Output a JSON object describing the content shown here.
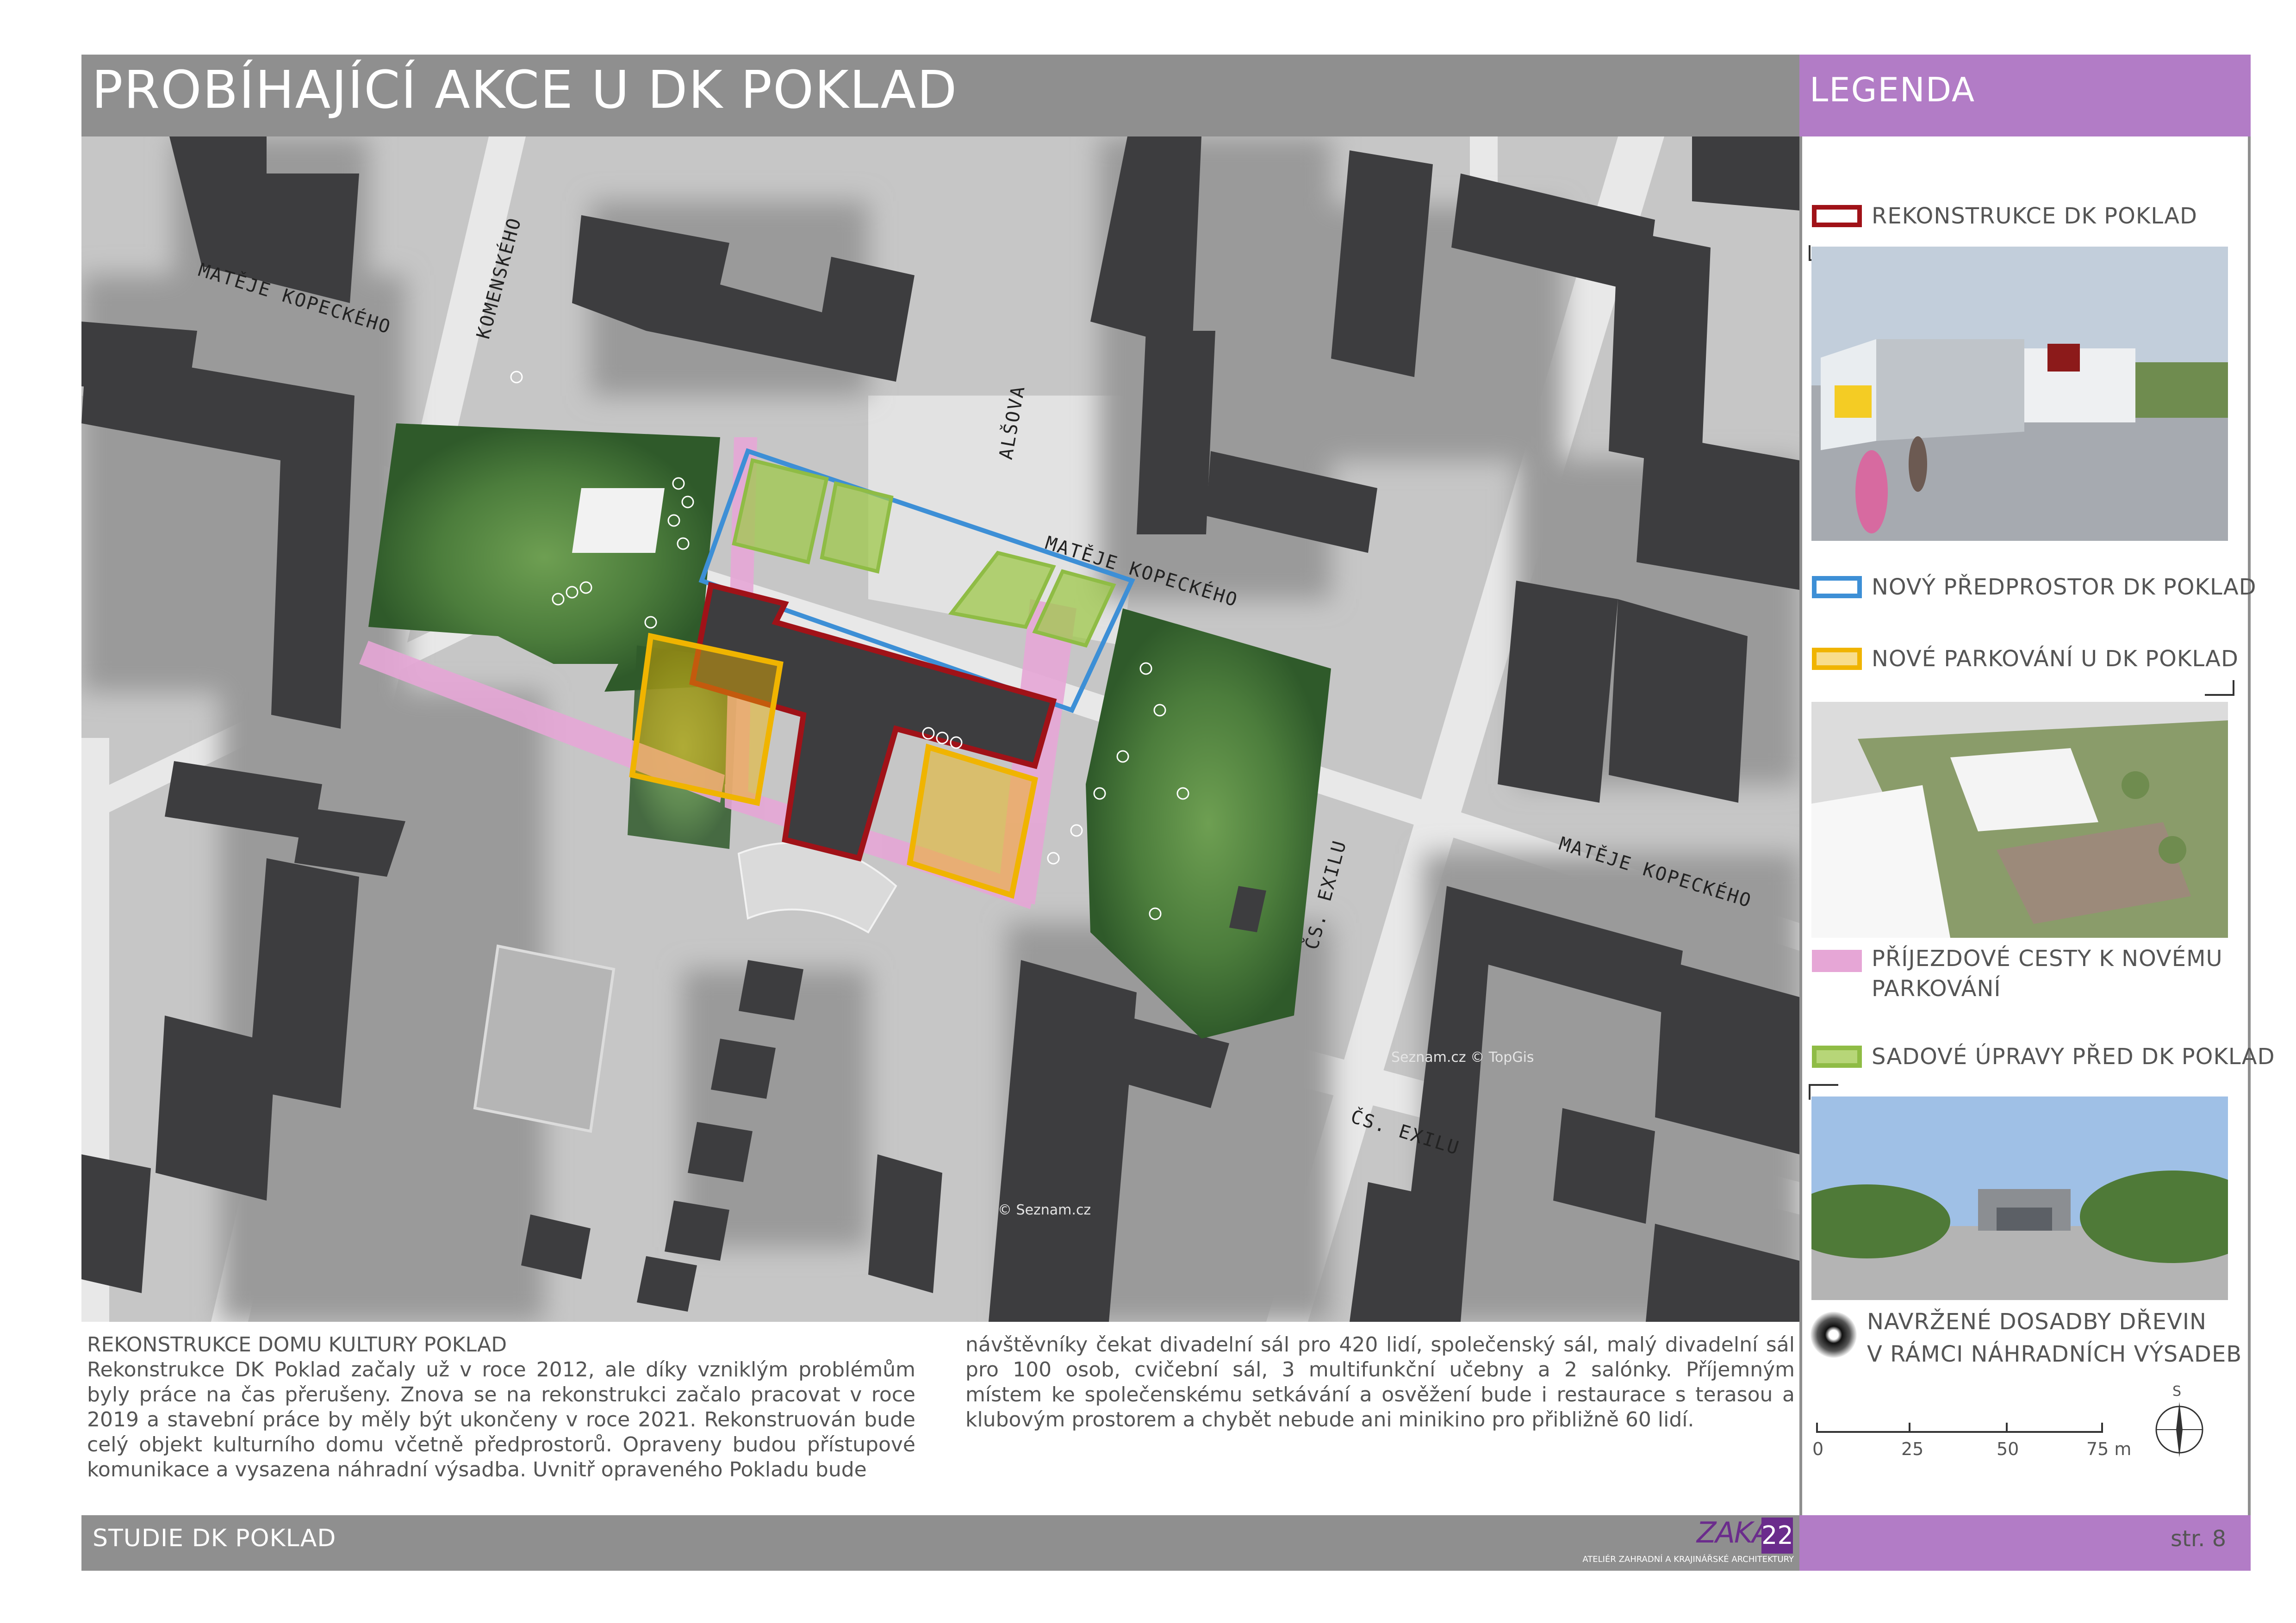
{
  "header": {
    "title": "PROBÍHAJÍCÍ AKCE U DK POKLAD",
    "legend_title": "LEGENDA"
  },
  "map": {
    "streets": {
      "s1": "MATĚJE KOPECKÉHO",
      "s2": "KOMENSKÉHO",
      "s3": "ALŠOVA",
      "s4": "MATĚJE KOPECKÉHO",
      "s5": "MATĚJE KOPECKÉHO",
      "s6": "ČS. EXILU",
      "s7": "ČS. EXILU"
    },
    "watermarks": {
      "w1": "© Seznam.cz",
      "w2": "Seznam.cz © TopGis"
    }
  },
  "legend": {
    "items": [
      {
        "label": "REKONSTRUKCE DK POKLAD",
        "color": "#a01218"
      },
      {
        "label": "NOVÝ PŘEDPROSTOR DK POKLAD",
        "color": "#3d8fd6"
      },
      {
        "label": "NOVÉ PARKOVÁNÍ U DK POKLAD",
        "color": "#f0b400"
      },
      {
        "label_line1": "PŘÍJEZDOVÉ CESTY K NOVÉMU",
        "label_line2": "PARKOVÁNÍ",
        "color": "#e6a6d6"
      },
      {
        "label": "SADOVÉ ÚPRAVY PŘED DK POKLAD",
        "color": "#8fbc45"
      }
    ],
    "trees_line1": "NAVRŽENÉ DOSADBY DŘEVIN",
    "trees_line2": "V RÁMCI NÁHRADNÍCH VÝSADEB",
    "scale": {
      "t0": "0",
      "t1": "25",
      "t2": "50",
      "t3": "75 m"
    },
    "north": "S",
    "accent_purple": "#b27cc6"
  },
  "body": {
    "heading": "REKONSTRUKCE DOMU KULTURY POKLAD",
    "paragraph_left": "Rekonstrukce DK Poklad začaly už v roce 2012, ale díky vzniklým problémům byly práce na čas přerušeny. Znova se na rekonstrukci začalo pracovat v roce 2019 a stavební práce by měly být ukončeny v roce 2021. Rekonstruován bude celý objekt kulturního domu včetně předprostorů. Opraveny budou přístupové komunikace a vysazena náhradní výsadba. Uvnitř opraveného Pokladu bude",
    "paragraph_right": "návštěvníky čekat divadelní sál pro 420 lidí, společenský sál, malý divadelní sál pro 100 osob, cvičební sál, 3 multifunkční učebny a 2 salónky. Příjemným místem ke společenskému setkávání a osvěžení bude i restaurace s terasou a klubovým prostorem a chybět nebude ani minikino pro přibližně 60 lidí."
  },
  "footer": {
    "left": "STUDIE DK POKLAD",
    "logo": "ZAKA",
    "logo_num": "22",
    "logo_sub": "ATELIÉR ZAHRADNÍ A KRAJINÁŘSKÉ ARCHITEKTURY",
    "page": "str. 8"
  }
}
